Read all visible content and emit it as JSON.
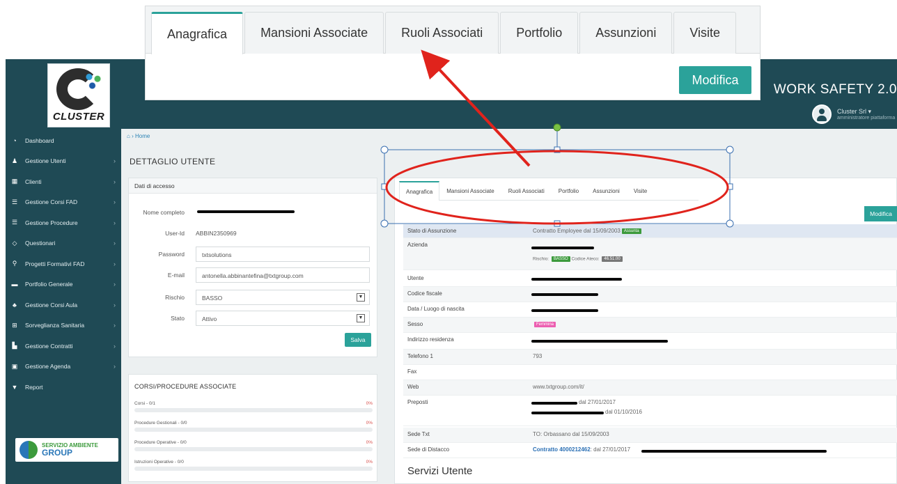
{
  "overlay": {
    "tabs": [
      "Anagrafica",
      "Mansioni Associate",
      "Ruoli Associati",
      "Portfolio",
      "Assunzioni",
      "Visite"
    ],
    "modifica_label": "Modifica"
  },
  "header": {
    "brand": "WORK SAFETY 2.0",
    "user_name": "Cluster Srl",
    "user_role": "amministratore piattaforma"
  },
  "logo": {
    "text": "CLUSTER"
  },
  "sidebar": {
    "items": [
      {
        "label": "Dashboard",
        "icon": "dashboard-icon",
        "glyph": "◔",
        "has_children": false
      },
      {
        "label": "Gestione Utenti",
        "icon": "user-icon",
        "glyph": "♟",
        "has_children": true
      },
      {
        "label": "Clienti",
        "icon": "building-icon",
        "glyph": "▦",
        "has_children": true
      },
      {
        "label": "Gestione Corsi FAD",
        "icon": "list-icon",
        "glyph": "☰",
        "has_children": true
      },
      {
        "label": "Gestione Procedure",
        "icon": "list-icon",
        "glyph": "☰",
        "has_children": true
      },
      {
        "label": "Questionari",
        "icon": "diamond-icon",
        "glyph": "◇",
        "has_children": true
      },
      {
        "label": "Progetti Formativi FAD",
        "icon": "sitemap-icon",
        "glyph": "⚲",
        "has_children": true
      },
      {
        "label": "Portfolio Generale",
        "icon": "folder-icon",
        "glyph": "▬",
        "has_children": true
      },
      {
        "label": "Gestione Corsi Aula",
        "icon": "group-icon",
        "glyph": "♣",
        "has_children": true
      },
      {
        "label": "Sorveglianza Sanitaria",
        "icon": "medical-icon",
        "glyph": "⊞",
        "has_children": true
      },
      {
        "label": "Gestione Contratti",
        "icon": "bar-chart-icon",
        "glyph": "▙",
        "has_children": true
      },
      {
        "label": "Gestione Agenda",
        "icon": "calendar-icon",
        "glyph": "▣",
        "has_children": true
      },
      {
        "label": "Report",
        "icon": "filter-icon",
        "glyph": "▼",
        "has_children": false
      }
    ],
    "partner_logo": {
      "line1": "SERVIZIO AMBIENTE",
      "line2": "GROUP"
    }
  },
  "breadcrumb": {
    "home": "Home"
  },
  "page_title": "DETTAGLIO UTENTE",
  "access": {
    "title": "Dati di accesso",
    "nome_label": "Nome completo",
    "userid_label": "User-Id",
    "userid_value": "ABBIN2350969",
    "password_label": "Password",
    "password_value": "txtsolutions",
    "email_label": "E-mail",
    "email_value": "antonella.abbinantefina@txtgroup.com",
    "rischio_label": "Rischio",
    "rischio_value": "BASSO",
    "stato_label": "Stato",
    "stato_value": "Attivo",
    "save_label": "Salva"
  },
  "corsi": {
    "title": "CORSI/PROCEDURE ASSOCIATE",
    "rows": [
      {
        "label": "Corsi - 0/1",
        "pct": "0%"
      },
      {
        "label": "Procedure Gestionali - 0/0",
        "pct": "0%"
      },
      {
        "label": "Procedure Operative - 0/0",
        "pct": "0%"
      },
      {
        "label": "Istruzioni Operative - 0/0",
        "pct": "0%"
      }
    ]
  },
  "detail": {
    "tabs": [
      "Anagrafica",
      "Mansioni Associate",
      "Ruoli Associati",
      "Portfolio",
      "Assunzioni",
      "Visite"
    ],
    "modifica_label": "Modifica",
    "stato_label": "Stato di Assunzione",
    "stato_value": "Contratto Employee dal 15/09/2003",
    "stato_badge": "Assunta",
    "azienda_label": "Azienda",
    "rischio_prefix": "Rischio:",
    "rischio_badge": "BASSO",
    "ateco_prefix": "Codice Ateco:",
    "ateco_badge": "46.51.00",
    "utente_label": "Utente",
    "cf_label": "Codice fiscale",
    "nascita_label": "Data / Luogo di nascita",
    "sesso_label": "Sesso",
    "sesso_badge": "Femmina",
    "indirizzo_label": "Indirizzo residenza",
    "telefono_label": "Telefono 1",
    "telefono_value": "793",
    "fax_label": "Fax",
    "web_label": "Web",
    "web_value": "www.txtgroup.com/it/",
    "preposti_label": "Preposti",
    "preposti_line1": "dal 27/01/2017",
    "preposti_line2": "dal 01/10/2016",
    "sede_label": "Sede Txt",
    "sede_value": "TO: Orbassano dal 15/09/2003",
    "distacco_label": "Sede di Distacco",
    "distacco_link": "Contratto 4000212462",
    "distacco_value": ": dal 27/01/2017",
    "servizi_title": "Servizi Utente"
  },
  "colors": {
    "sidebar_bg": "#1f4a55",
    "accent_teal": "#2ba29a",
    "annotation_red": "#e0231c",
    "handle_green": "#7ac143",
    "badge_green": "#3c9a3c",
    "badge_pink": "#ec5fb1"
  }
}
